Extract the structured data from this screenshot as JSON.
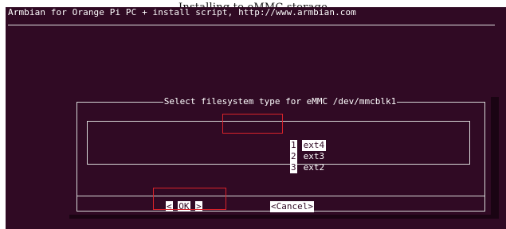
{
  "page_header": "Installing to eMMC storage",
  "terminal": {
    "title": "Armbian for Orange Pi PC + install script, http://www.armbian.com"
  },
  "dialog": {
    "title": "Select filesystem type for eMMC /dev/mmcblk1",
    "items": [
      {
        "tag": "1",
        "label": "ext4",
        "selected": true
      },
      {
        "tag": "2",
        "label": "ext3",
        "selected": false
      },
      {
        "tag": "3",
        "label": "ext2",
        "selected": false
      }
    ],
    "buttons": {
      "ok_label": "OK",
      "cancel_label": "<Cancel>"
    }
  },
  "colors": {
    "terminal_bg": "#300a24",
    "text": "#ffffff",
    "highlight": "#d8232a"
  }
}
